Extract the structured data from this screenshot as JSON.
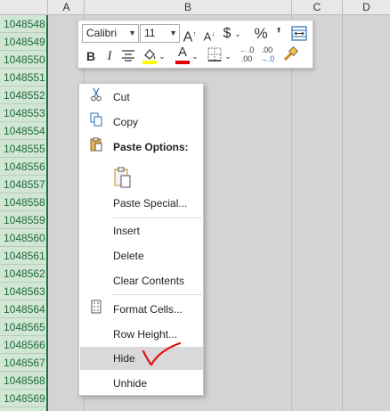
{
  "columns": [
    "A",
    "B",
    "C",
    "D"
  ],
  "rows": [
    "1048548",
    "1048549",
    "1048550",
    "1048551",
    "1048552",
    "1048553",
    "1048554",
    "1048555",
    "1048556",
    "1048557",
    "1048558",
    "1048559",
    "1048560",
    "1048561",
    "1048562",
    "1048563",
    "1048564",
    "1048565",
    "1048566",
    "1048567",
    "1048568",
    "1048569"
  ],
  "mini_toolbar": {
    "font_name": "Calibri",
    "font_size": "11",
    "grow_font": "A",
    "shrink_font": "A",
    "currency": "$",
    "percent": "%",
    "comma": "’",
    "bold": "B",
    "italic": "I",
    "font_color": "A",
    "increase_decimal": ".0",
    "decrease_decimal": ".00"
  },
  "menu": {
    "cut": "Cut",
    "copy": "Copy",
    "paste_options": "Paste Options:",
    "paste_special": "Paste Special...",
    "insert": "Insert",
    "delete": "Delete",
    "clear_contents": "Clear Contents",
    "format_cells": "Format Cells...",
    "row_height": "Row Height...",
    "hide": "Hide",
    "unhide": "Unhide"
  },
  "colors": {
    "row_header_selected": "#d2e6d4",
    "row_header_text": "#1e6b3e",
    "selection_border": "#1e7145",
    "menu_highlight": "#d9d9d9",
    "annotation": "#e01010",
    "highlight_yellow": "#ffff00",
    "font_red": "#e00000"
  }
}
